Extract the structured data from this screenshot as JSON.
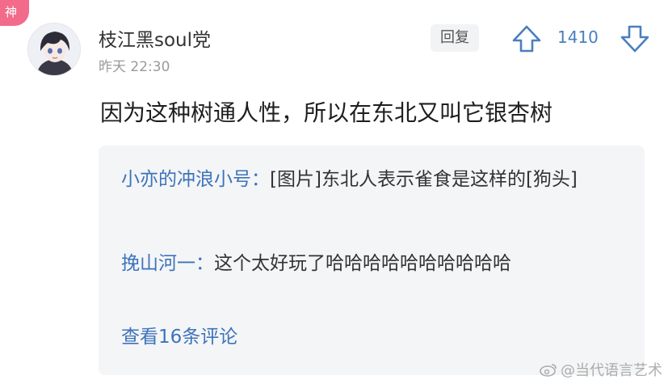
{
  "badge": {
    "label": "神"
  },
  "comment": {
    "username": "枝江黑soul党",
    "time": "昨天 22:30",
    "reply_label": "回复",
    "vote_count": "1410",
    "text": "因为这种树通人性，所以在东北又叫它银杏树"
  },
  "replies": [
    {
      "author": "小亦的冲浪小号",
      "separator": "：",
      "text": "[图片]东北人表示雀食是这样的[狗头]"
    },
    {
      "author": "挽山河一",
      "separator": "：",
      "text": "这个太好玩了哈哈哈哈哈哈哈哈哈哈"
    }
  ],
  "view_more": "查看16条评论",
  "watermark": {
    "text": "@当代语言艺术"
  },
  "colors": {
    "accent_blue": "#3d73ba",
    "badge_pink": "#f26b8a",
    "reply_bg": "#f4f5f7"
  },
  "icons": [
    "upvote-arrow-icon",
    "downvote-arrow-icon",
    "weibo-logo-icon"
  ]
}
